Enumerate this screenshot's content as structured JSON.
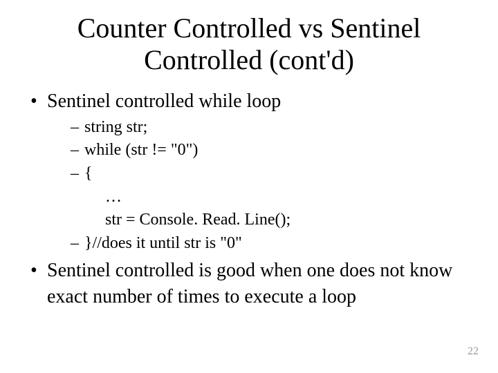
{
  "title": "Counter Controlled vs Sentinel Controlled (cont'd)",
  "bullet1": "Sentinel controlled while loop",
  "sub": {
    "l1": "string str;",
    "l2": "while (str != \"0\")",
    "l3": "{",
    "l4": "…",
    "l5": "str = Console. Read. Line();",
    "l6": "}//does it until str is \"0\""
  },
  "bullet2": "Sentinel controlled is good when one does not know exact number of times to execute a loop",
  "pageNumber": "22"
}
